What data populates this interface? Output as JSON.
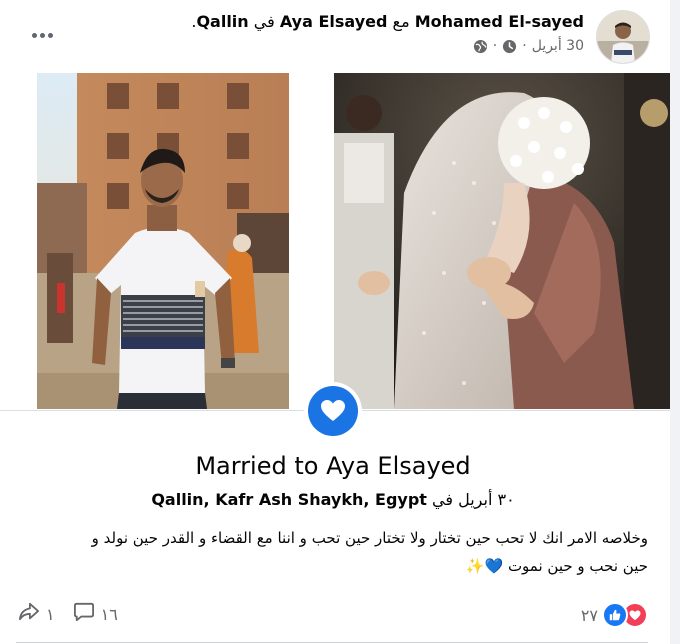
{
  "post": {
    "author": "Mohamed El-sayed",
    "with_word": "مع",
    "tagged": "Aya Elsayed",
    "in_word": "في",
    "place": "Qallin",
    "period": ".",
    "date": "30 أبريل",
    "sep": "·",
    "icons": [
      "clock-icon",
      "globe-icon"
    ]
  },
  "life_event": {
    "title": "Married to Aya Elsayed",
    "date_prefix": "٣٠ أبريل في",
    "location": "Qallin, Kafr Ash Shaykh, Egypt",
    "icon": "heart-icon"
  },
  "caption": {
    "line1": "وخلاصه الامر انك لا تحب حين تختار ولا تختار حين تحب و اننا مع القضاء و القدر حين نولد و",
    "line2": "حين نحب و حين نموت",
    "emoji": "💙✨"
  },
  "footer": {
    "reactions_count": "٢٧",
    "comments_count": "١٦",
    "shares_count": "١"
  },
  "colors": {
    "accent": "#1b74e4",
    "like": "#1877f2",
    "love": "#f33e58",
    "secondary_text": "#65676b"
  }
}
